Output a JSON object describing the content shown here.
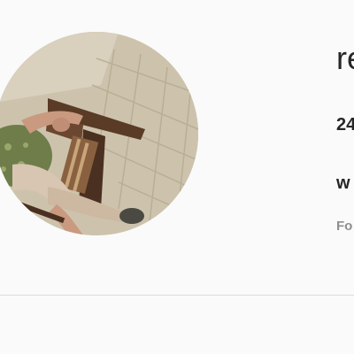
{
  "profile": {
    "username": "re",
    "posts_count": "24",
    "full_name": "w",
    "followed_by": "Fo"
  },
  "avatar": {
    "icon": "profile-photo"
  },
  "colors": {
    "background": "#fafafa",
    "text": "#262626",
    "muted": "#8e8e8e",
    "divider": "#dbdbdb"
  }
}
